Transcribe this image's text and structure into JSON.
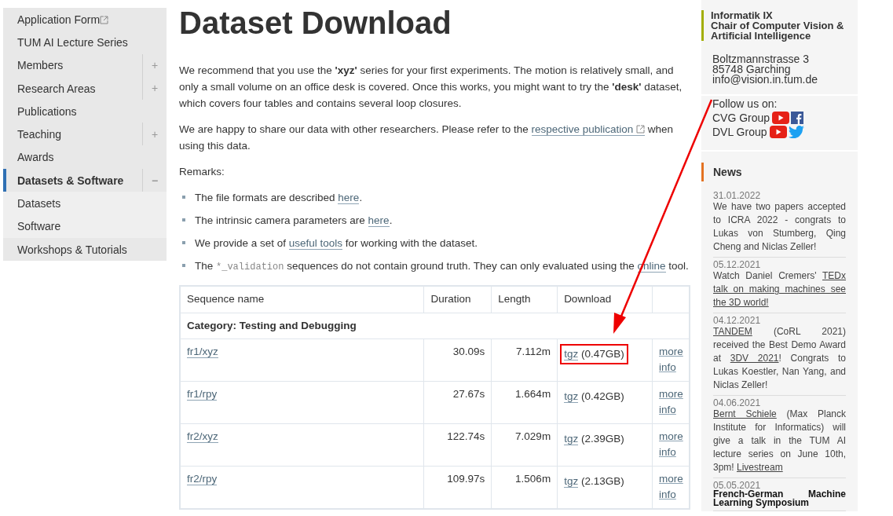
{
  "sidebar": {
    "items": [
      {
        "label": "Application Form",
        "external": true,
        "selected": false
      },
      {
        "label": "TUM AI Lecture Series",
        "selected": false
      },
      {
        "label": "Members",
        "toggle": "+",
        "selected": false
      },
      {
        "label": "Research Areas",
        "toggle": "+",
        "selected": false
      },
      {
        "label": "Publications",
        "selected": false
      },
      {
        "label": "Teaching",
        "toggle": "+",
        "selected": false
      },
      {
        "label": "Awards",
        "selected": false
      },
      {
        "label": "Datasets & Software",
        "toggle": "−",
        "selected": true,
        "children": [
          {
            "label": "Datasets",
            "selected": false
          },
          {
            "label": "Software",
            "selected": false
          }
        ]
      },
      {
        "label": "Workshops & Tutorials",
        "selected": false
      }
    ]
  },
  "main": {
    "title": "Dataset Download",
    "paragraphs": [
      [
        {
          "kind": "text",
          "text": "We recommend that you use the **'xyz'** series for your first experiments. The motion is relatively small, and only a small volume on an office desk is covered. Once this works, you might want to try the **'desk'** dataset, which covers four tables and contains several loop closures."
        }
      ],
      [
        {
          "kind": "text",
          "text": "We are happy to share our data with other researchers. Please refer to the "
        },
        {
          "kind": "extlink",
          "text": "respective publication"
        },
        {
          "kind": "text",
          "text": " when using this data."
        }
      ],
      [
        {
          "kind": "text",
          "text": "Remarks:"
        }
      ]
    ],
    "remarks": [
      [
        {
          "kind": "text",
          "text": "The file formats are described "
        },
        {
          "kind": "link",
          "text": "here"
        },
        {
          "kind": "text",
          "text": "."
        }
      ],
      [
        {
          "kind": "text",
          "text": "The intrinsic camera parameters are "
        },
        {
          "kind": "link",
          "text": "here"
        },
        {
          "kind": "text",
          "text": "."
        }
      ],
      [
        {
          "kind": "text",
          "text": "We provide a set of "
        },
        {
          "kind": "link",
          "text": "useful tools"
        },
        {
          "kind": "text",
          "text": " for working with the dataset."
        }
      ],
      [
        {
          "kind": "text",
          "text": "The "
        },
        {
          "kind": "code",
          "text": "*_validation"
        },
        {
          "kind": "text",
          "text": " sequences do not contain ground truth. They can only evaluated using the "
        },
        {
          "kind": "link",
          "text": "online"
        },
        {
          "kind": "text",
          "text": " tool."
        }
      ]
    ],
    "table": {
      "columns": [
        "Sequence name",
        "Duration",
        "Length",
        "Download"
      ],
      "category": "Category: Testing and Debugging",
      "rows": [
        {
          "name": "fr1/xyz",
          "duration": "30.09s",
          "length": "7.112m",
          "download": "tgz",
          "size": "(0.47GB)",
          "info": "more info",
          "highlighted": true
        },
        {
          "name": "fr1/rpy",
          "duration": "27.67s",
          "length": "1.664m",
          "download": "tgz",
          "size": "(0.42GB)",
          "info": "more info",
          "highlighted": false
        },
        {
          "name": "fr2/xyz",
          "duration": "122.74s",
          "length": "7.029m",
          "download": "tgz",
          "size": "(2.39GB)",
          "info": "more info",
          "highlighted": false
        },
        {
          "name": "fr2/rpy",
          "duration": "109.97s",
          "length": "1.506m",
          "download": "tgz",
          "size": "(2.13GB)",
          "info": "more info",
          "highlighted": false
        }
      ]
    }
  },
  "aside": {
    "institute": [
      "Informatik IX",
      "Chair of Computer Vision & Artificial Intelligence"
    ],
    "address": [
      "Boltzmannstrasse 3",
      "85748 Garching",
      "info@vision.in.tum.de"
    ],
    "follow_label": "Follow us on:",
    "groups": [
      {
        "name": "CVG Group",
        "links": [
          {
            "kind": "youtube"
          },
          {
            "kind": "facebook"
          }
        ]
      },
      {
        "name": "DVL Group",
        "links": [
          {
            "kind": "youtube"
          },
          {
            "kind": "twitter"
          }
        ]
      }
    ],
    "news_title": "News",
    "news": [
      {
        "date": "31.01.2022",
        "body": [
          {
            "kind": "text",
            "text": "We have two papers accepted to ICRA 2022 - congrats to Lukas von Stumberg, Qing Cheng and Niclas Zeller!"
          }
        ]
      },
      {
        "date": "05.12.2021",
        "body": [
          {
            "kind": "text",
            "text": "Watch Daniel Cremers' "
          },
          {
            "kind": "link",
            "parts": [
              "TEDx",
              "talk on making machines see",
              "the 3D world!"
            ]
          }
        ]
      },
      {
        "date": "04.12.2021",
        "body": [
          {
            "kind": "link",
            "text": "TANDEM"
          },
          {
            "kind": "text",
            "text": " (CoRL 2021) received the Best Demo Award at "
          },
          {
            "kind": "link",
            "text": "3DV 2021"
          },
          {
            "kind": "text",
            "text": "! Congrats to Lukas Koestler, Nan Yang, and Niclas Zeller!"
          }
        ]
      },
      {
        "date": "04.06.2021",
        "body": [
          {
            "kind": "link",
            "text": "Bernt Schiele"
          },
          {
            "kind": "text",
            "text": " (Max Planck Institute for Informatics) will give a talk in the TUM AI lecture series on June 10th, 3pm! "
          },
          {
            "kind": "link",
            "text": "Livestream"
          }
        ]
      },
      {
        "date": "05.05.2021",
        "body": [
          {
            "kind": "headline",
            "text": "French-German Machine Learning Symposium"
          }
        ]
      }
    ]
  }
}
